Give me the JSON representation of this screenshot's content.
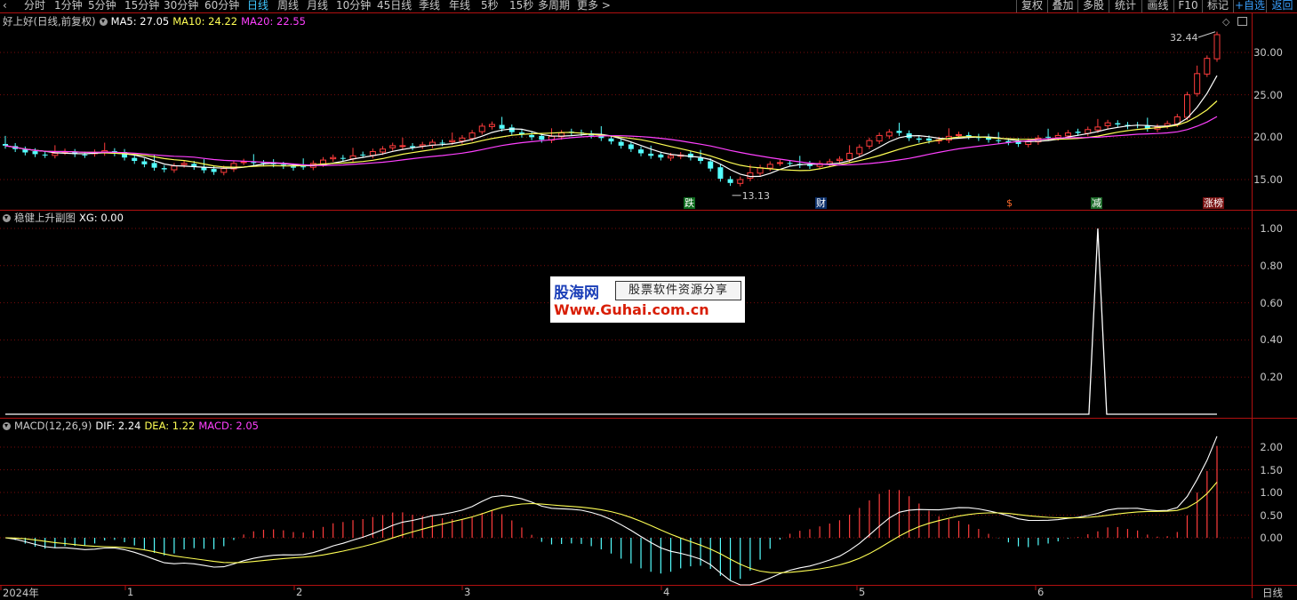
{
  "toolbar": {
    "periods": [
      "分时",
      "1分钟",
      "5分钟",
      "15分钟",
      "30分钟",
      "60分钟",
      "日线",
      "周线",
      "月线",
      "10分钟",
      "45日线",
      "季线",
      "年线",
      "5秒",
      "15秒",
      "多周期",
      "更多 >"
    ],
    "active_period": "日线",
    "right_buttons": [
      "复权",
      "叠加",
      "多股",
      "统计",
      "画线",
      "F10",
      "标记",
      "+自选",
      "返回"
    ]
  },
  "main_panel": {
    "title": "好上好(日线,前复权)",
    "ma5_label": "MA5: 27.05",
    "ma10_label": "MA10: 24.22",
    "ma20_label": "MA20: 22.55",
    "high_marker": "32.44",
    "low_marker": "13.13",
    "y_ticks": [
      "30.00",
      "25.00",
      "20.00",
      "15.00"
    ],
    "events": [
      "跌",
      "财",
      "$",
      "减",
      "涨榜"
    ]
  },
  "sub_panel": {
    "title": "稳健上升副图",
    "xg_label": "XG: 0.00",
    "y_ticks": [
      "1.00",
      "0.80",
      "0.60",
      "0.40",
      "0.20"
    ]
  },
  "macd_panel": {
    "title": "MACD(12,26,9)",
    "dif_label": "DIF: 2.24",
    "dea_label": "DEA: 1.22",
    "macd_label": "MACD: 2.05",
    "y_ticks": [
      "2.00",
      "1.50",
      "1.00",
      "0.50",
      "0.00"
    ]
  },
  "x_axis": {
    "labels": [
      "2024年",
      "1",
      "2",
      "3",
      "4",
      "5",
      "6"
    ],
    "period_label": "日线"
  },
  "watermark": {
    "logo": "股海网",
    "slogan": "股票软件资源分享",
    "url": "Www.Guhai.com.cn"
  },
  "colors": {
    "up": "#ff3c3c",
    "down": "#54ffff",
    "ma5": "#ffffff",
    "ma10": "#ffff54",
    "ma20": "#ff40ff",
    "frame": "#b01010"
  },
  "chart_data": [
    {
      "type": "candlestick",
      "title": "好上好(日线,前复权)",
      "series": [
        {
          "name": "MA5",
          "last": 27.05
        },
        {
          "name": "MA10",
          "last": 24.22
        },
        {
          "name": "MA20",
          "last": 22.55
        }
      ],
      "close": [
        19.0,
        18.6,
        18.2,
        18.0,
        17.9,
        18.1,
        18.3,
        18.0,
        17.9,
        18.2,
        18.4,
        18.1,
        17.6,
        17.2,
        16.8,
        16.4,
        16.2,
        16.6,
        16.9,
        16.5,
        16.1,
        15.9,
        16.3,
        16.9,
        17.1,
        17.0,
        16.9,
        16.8,
        16.6,
        16.4,
        16.5,
        16.9,
        17.3,
        17.6,
        17.5,
        17.8,
        17.9,
        18.3,
        18.6,
        19.0,
        19.0,
        18.8,
        19.1,
        19.4,
        19.3,
        19.6,
        19.9,
        20.5,
        21.3,
        21.5,
        21.0,
        20.6,
        20.3,
        20.0,
        19.7,
        20.1,
        20.5,
        20.6,
        20.5,
        20.2,
        19.9,
        19.5,
        19.0,
        18.6,
        18.1,
        17.8,
        17.6,
        17.8,
        17.9,
        17.6,
        17.2,
        16.3,
        15.1,
        14.6,
        15.0,
        15.8,
        16.4,
        16.8,
        17.0,
        16.9,
        16.7,
        16.6,
        16.9,
        17.1,
        17.4,
        18.1,
        18.8,
        19.6,
        20.2,
        20.6,
        20.5,
        19.9,
        19.7,
        19.6,
        19.7,
        20.1,
        20.3,
        20.1,
        19.9,
        19.7,
        19.6,
        19.4,
        19.2,
        19.5,
        19.9,
        20.0,
        20.2,
        20.5,
        20.5,
        20.9,
        21.2,
        21.7,
        21.5,
        21.3,
        21.4,
        21.0,
        21.2,
        21.6,
        22.4,
        25.0,
        27.5,
        29.3,
        32.1
      ],
      "high_marker": 32.44,
      "low_marker": 13.13,
      "ylim": [
        12.5,
        34.5
      ],
      "x_labels": [
        "2024年",
        "1",
        "2",
        "3",
        "4",
        "5",
        "6"
      ]
    },
    {
      "type": "line",
      "title": "稳健上升副图",
      "series": [
        {
          "name": "XG",
          "spike_index": 110,
          "spike_value": 1.0,
          "baseline": 0.0
        }
      ],
      "ylim": [
        0,
        1.0
      ]
    },
    {
      "type": "line",
      "title": "MACD(12,26,9)",
      "series": [
        {
          "name": "DIF",
          "last": 2.24
        },
        {
          "name": "DEA",
          "last": 1.22
        },
        {
          "name": "MACD",
          "last": 2.05
        }
      ],
      "ylim": [
        -0.95,
        2.35
      ]
    }
  ]
}
